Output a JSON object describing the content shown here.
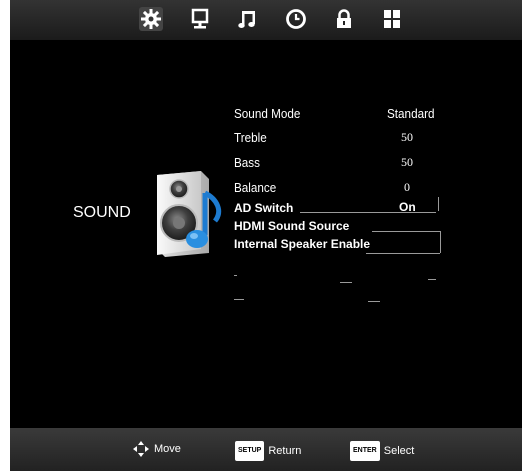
{
  "top_tabs": [
    {
      "name": "picture-settings-icon",
      "active": true
    },
    {
      "name": "display-icon",
      "active": false
    },
    {
      "name": "sound-icon",
      "active": false
    },
    {
      "name": "time-icon",
      "active": false
    },
    {
      "name": "lock-icon",
      "active": false
    },
    {
      "name": "setup-icon",
      "active": false
    }
  ],
  "menu": {
    "title": "SOUND",
    "items": [
      {
        "label": "Sound Mode",
        "value": "Standard"
      },
      {
        "label": "Treble",
        "value": "50"
      },
      {
        "label": "Bass",
        "value": "50"
      },
      {
        "label": "Balance",
        "value": "0"
      },
      {
        "label": "AD Switch",
        "value": "On"
      },
      {
        "label": "HDMI Sound Source",
        "value": ""
      },
      {
        "label": "Internal Speaker Enable",
        "value": ""
      }
    ]
  },
  "footer": {
    "move_label": "Move",
    "return_key": "SETUP",
    "return_label": "Return",
    "select_key": "ENTER",
    "select_label": "Select"
  },
  "colors": {
    "background": "#000000",
    "text": "#ffffff",
    "speaker_accent": "#2a8fe0"
  }
}
